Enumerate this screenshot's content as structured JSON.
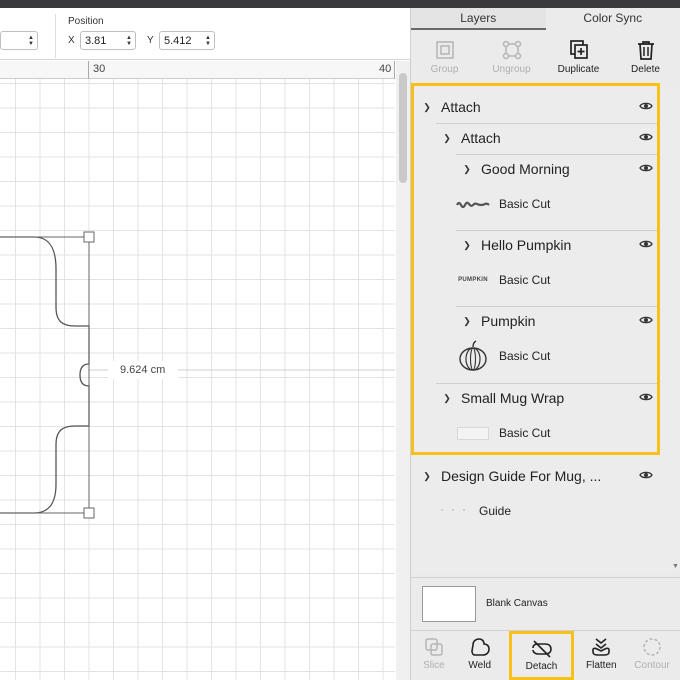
{
  "toolbar": {
    "left_value": "",
    "position_label": "Position",
    "x_label": "X",
    "x_value": "3.81",
    "y_label": "Y",
    "y_value": "5.412"
  },
  "ruler": {
    "marks": [
      "30",
      "40"
    ]
  },
  "canvas": {
    "dimension_label": "9.624 cm"
  },
  "panel": {
    "tabs": [
      {
        "label": "Layers",
        "active": true
      },
      {
        "label": "Color Sync",
        "active": false
      }
    ],
    "actions": [
      {
        "label": "Group",
        "icon": "group-icon",
        "enabled": false
      },
      {
        "label": "Ungroup",
        "icon": "ungroup-icon",
        "enabled": false
      },
      {
        "label": "Duplicate",
        "icon": "duplicate-icon",
        "enabled": true
      },
      {
        "label": "Delete",
        "icon": "trash-icon",
        "enabled": true
      }
    ],
    "layers": {
      "attach_outer": "Attach",
      "attach_inner": "Attach",
      "good_morning": {
        "name": "Good Morning",
        "operation": "Basic Cut"
      },
      "hello_pumpkin": {
        "name": "Hello Pumpkin",
        "operation": "Basic Cut",
        "thumb_text": "PUMPKIN"
      },
      "pumpkin": {
        "name": "Pumpkin",
        "operation": "Basic Cut"
      },
      "small_mug_wrap": {
        "name": "Small Mug Wrap",
        "operation": "Basic Cut"
      },
      "design_guide": {
        "name": "Design Guide For Mug, ...",
        "operation": "Guide"
      }
    },
    "blank_canvas_label": "Blank Canvas",
    "bottom_actions": [
      {
        "label": "Slice",
        "icon": "slice-icon",
        "enabled": false
      },
      {
        "label": "Weld",
        "icon": "weld-icon",
        "enabled": true
      },
      {
        "label": "Detach",
        "icon": "detach-icon",
        "enabled": true,
        "highlighted": true
      },
      {
        "label": "Flatten",
        "icon": "flatten-icon",
        "enabled": true
      },
      {
        "label": "Contour",
        "icon": "contour-icon",
        "enabled": false
      }
    ]
  },
  "colors": {
    "highlight": "#f7c117",
    "panel_bg": "#ebebeb",
    "grid_line": "#e3e3e3"
  }
}
